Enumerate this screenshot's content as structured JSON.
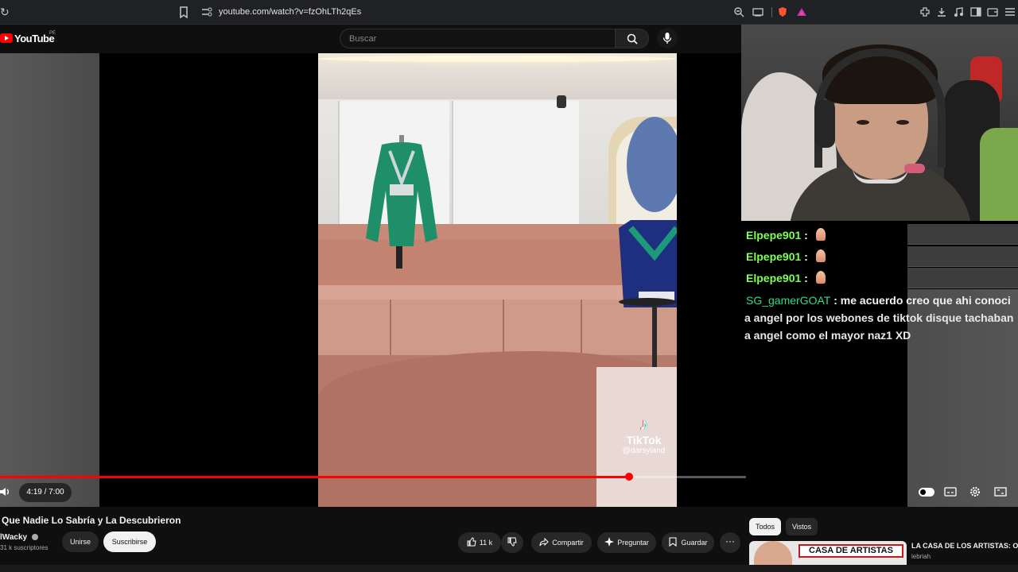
{
  "browser": {
    "url": "youtube.com/watch?v=fzOhLTh2qEs"
  },
  "header": {
    "logo_text": "YouTube",
    "logo_region": "PE",
    "search_placeholder": "Buscar"
  },
  "video": {
    "tiktok_brand": "TikTok",
    "tiktok_user": "@darsyland",
    "time": "4:19 / 7:00",
    "progress": 0.843
  },
  "chat": {
    "messages": [
      {
        "user": "Elpepe901",
        "sep": ":",
        "text": ""
      },
      {
        "user": "Elpepe901",
        "sep": ":",
        "text": ""
      },
      {
        "user": "Elpepe901",
        "sep": ":",
        "text": ""
      },
      {
        "user": "SG_gamerGOAT",
        "sep": ":",
        "text": "me acuerdo creo que ahi conoci",
        "line2": "a angel por los webones de tiktok disque tachaban",
        "line3": "a angel como el mayor naz1 XD"
      }
    ]
  },
  "below": {
    "title": "Que Nadie Lo Sabría y La Descubrieron",
    "channel": "lWacky",
    "subscribers": "31 k suscriptores",
    "join_label": "Unirse",
    "subscribe_label": "Suscribirse",
    "likes": "11 k",
    "share_label": "Compartir",
    "ask_label": "Preguntar",
    "save_label": "Guardar",
    "more_label": "···"
  },
  "sidebar": {
    "chip_all": "Todos",
    "chip_watched": "Vistos",
    "rec_thumb_text": "CASA DE ARTISTAS",
    "rec_title": "LA CASA DE LOS ARTISTAS: OVI",
    "rec_channel": "lebriah"
  },
  "colors": {
    "accent": "#ff0000",
    "chat_user": "#7dff54",
    "chat_user_alt": "#2bdc8c"
  }
}
